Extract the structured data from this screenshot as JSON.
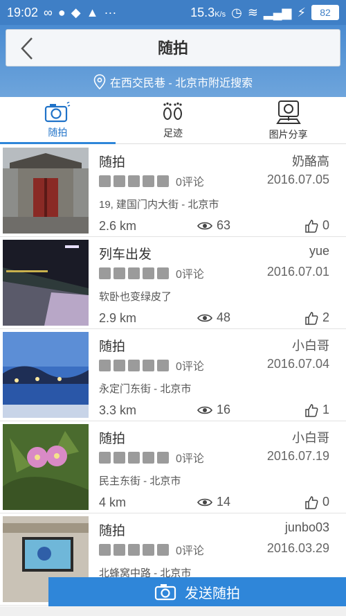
{
  "statusbar": {
    "time": "19:02",
    "speed": "15.3",
    "speed_unit": "K/s",
    "battery": "82"
  },
  "header": {
    "title": "随拍",
    "location": "在西交民巷 - 北京市附近搜索"
  },
  "tabs": [
    {
      "label": "随拍",
      "icon": "camera-icon",
      "active": true
    },
    {
      "label": "足迹",
      "icon": "footprint-icon",
      "active": false
    },
    {
      "label": "图片分享",
      "icon": "map-photo-icon",
      "active": false
    }
  ],
  "items": [
    {
      "title": "随拍",
      "user": "奶酪高",
      "comments": "0评论",
      "date": "2016.07.05",
      "address": "19, 建国门内大街 - 北京市",
      "distance": "2.6 km",
      "views": "63",
      "likes": "0"
    },
    {
      "title": "列车出发",
      "user": "yue",
      "comments": "0评论",
      "date": "2016.07.01",
      "address": "软卧也变绿皮了",
      "distance": "2.9 km",
      "views": "48",
      "likes": "2"
    },
    {
      "title": "随拍",
      "user": "小白哥",
      "comments": "0评论",
      "date": "2016.07.04",
      "address": "永定门东街 - 北京市",
      "distance": "3.3 km",
      "views": "16",
      "likes": "1"
    },
    {
      "title": "随拍",
      "user": "小白哥",
      "comments": "0评论",
      "date": "2016.07.19",
      "address": "民主东街 - 北京市",
      "distance": "4 km",
      "views": "14",
      "likes": "0"
    },
    {
      "title": "随拍",
      "user": "junbo03",
      "comments": "0评论",
      "date": "2016.03.29",
      "address": "北蜂窝中路 - 北京市",
      "distance": "",
      "views": "",
      "likes": ""
    }
  ],
  "send_button": {
    "label": "发送随拍"
  },
  "colors": {
    "accent": "#2f86d9",
    "header": "#4a8bd1"
  }
}
